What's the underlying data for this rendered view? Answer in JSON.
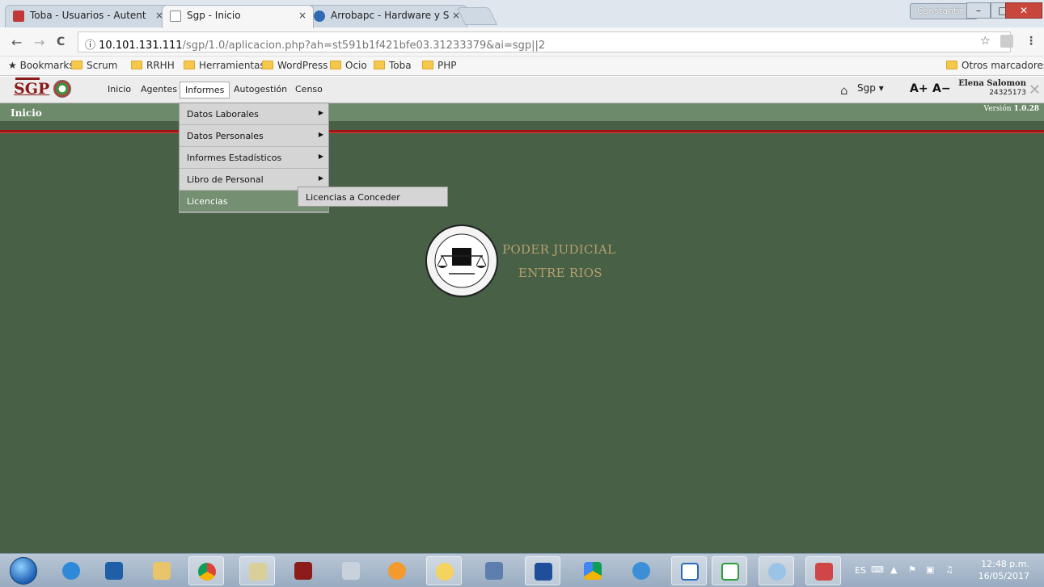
{
  "browser": {
    "tabs": [
      {
        "title": "Toba - Usuarios - Autent",
        "favicon": "toba-icon",
        "active": false
      },
      {
        "title": "Sgp - Inicio",
        "favicon": "page-icon",
        "active": true
      },
      {
        "title": "Arrobapc - Hardware y S",
        "favicon": "arrobapc-icon",
        "active": false
      }
    ],
    "tab_close": "×",
    "profile_name": "Constantino",
    "window_controls": {
      "minimize": "–",
      "maximize": "□",
      "close": "✕"
    },
    "nav": {
      "back": "←",
      "forward": "→",
      "reload": "C"
    },
    "url_host": "10.101.131.111",
    "url_path": "/sgp/1.0/aplicacion.php?ah=st591b1f421bfe03.31233379&ai=sgp||2",
    "info_icon": "ⓘ",
    "star": "☆",
    "menu": "⋮",
    "bookmarks": [
      "Bookmarks",
      "Scrum",
      "RRHH",
      "Herramientas",
      "WordPress",
      "Ocio",
      "Toba",
      "PHP"
    ],
    "other_bookmarks": "Otros marcadores"
  },
  "app": {
    "logo_text": "SGP",
    "menu": [
      "Inicio",
      "Agentes",
      "Informes",
      "Autogestión",
      "Censo"
    ],
    "project_select": "Sgp",
    "font_increase": "A+",
    "font_decrease": "A−",
    "user_name": "Elena Salomon",
    "user_id": "24325173",
    "page_title": "Inicio",
    "version_label": "Versión",
    "version": "1.0.28",
    "dropdown": [
      {
        "label": "Datos Laborales",
        "has_submenu": true
      },
      {
        "label": "Datos Personales",
        "has_submenu": true
      },
      {
        "label": "Informes Estadísticos",
        "has_submenu": true
      },
      {
        "label": "Libro de Personal",
        "has_submenu": true
      },
      {
        "label": "Licencias",
        "has_submenu": false,
        "highlighted": true
      }
    ],
    "submenu_item": "Licencias a Conceder",
    "emblem_line1": "PODER JUDICIAL",
    "emblem_line2": "ENTRE RIOS",
    "colors": {
      "background": "#476046",
      "title_bar": "#6d8a6b",
      "accent_rule": "#a01414",
      "emblem_text": "#b5a06e"
    }
  },
  "taskbar": {
    "apps": [
      "ie-icon",
      "outlook-icon",
      "explorer-icon",
      "chrome-icon",
      "mail-icon",
      "stamp-icon",
      "calculator-icon",
      "firefox-icon",
      "pidgin-icon",
      "network-icon",
      "save-icon",
      "drive-icon",
      "xtools-icon",
      "writer-icon",
      "calc-icon",
      "paint-icon",
      "snipping-icon"
    ],
    "language": "ES",
    "time": "12:48 p.m.",
    "date": "16/05/2017"
  }
}
